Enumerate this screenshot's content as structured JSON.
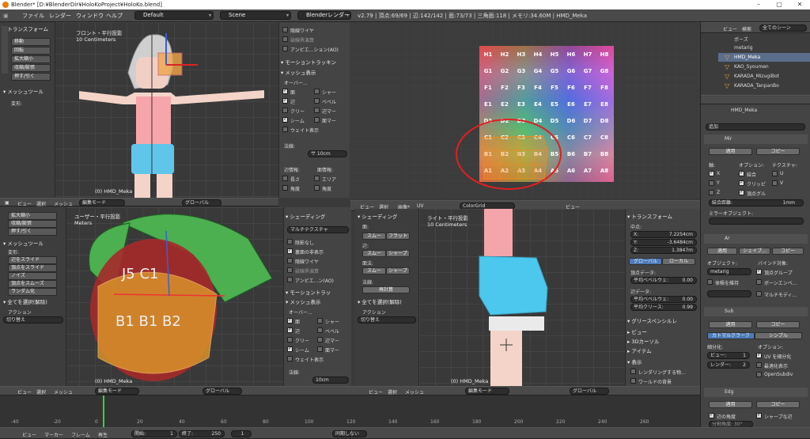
{
  "title": "Blender* [D:¥BlenderDir¥HoloKoProject¥HoloKo.blend]",
  "menu": [
    "ファイル",
    "レンダー",
    "ウィンドウ",
    "ヘルプ"
  ],
  "layout": "Default",
  "scene": "Scene",
  "engine": "Blenderレンダー",
  "stats": "v2.79 | 頂点:69/69 | 辺:142/142 | 面:73/73 | 三角面:118 | メモリ:34.60M | HMD_Meka",
  "left_tools": {
    "header": "▾ トランスフォーム",
    "buttons": [
      "移動",
      "回転",
      "拡大縮小",
      "収縮/膨張",
      "押す/引く"
    ],
    "mesh_tools": "▾ メッシュツール",
    "deform": "変形:"
  },
  "vp_tl": {
    "label": "フロント・平行投影",
    "units": "10 Centimeters",
    "obj": "(0) HMD_Meka"
  },
  "vp_bl": {
    "label": "ユーザー・平行投影",
    "units": "Meters",
    "obj": "(0) HMD_Meka"
  },
  "vp_br": {
    "label": "ライト・平行投影",
    "units": "10 Centimeters",
    "obj": "(0) HMD_Meka"
  },
  "mid_panel_top": {
    "items": [
      "隠線ワイヤ",
      "破線界演算",
      "アンビエ...ション(AO)"
    ],
    "motion": "▾ モーショントラッキン",
    "mesh_display": "▾ メッシュ表示",
    "overlay": "オーバー...",
    "opts": [
      [
        "面",
        "シャー"
      ],
      [
        "辺",
        "ベベル"
      ],
      [
        "クリー",
        "辺マー"
      ],
      [
        "シーム",
        "面マー"
      ]
    ],
    "weight": "ウェイト表示",
    "normal": "法線:",
    "size": "サ 10cm",
    "edge_info": "辺情報:",
    "face_info": "面情報:",
    "l1": "長さ",
    "l2": "エリア",
    "l3": "角度",
    "l4": "角度"
  },
  "mid_panel_bot": {
    "shading": "▾ シェーディング",
    "matcap": "マルチテクスチャ",
    "items": [
      "陰影なし",
      "裏面の非表示",
      "隠線ワイヤ",
      "破線界演算",
      "アンビエ...ン(AO)"
    ],
    "motion": "▾ モーショントラッ",
    "mesh_display": "▾ メッシュ表示",
    "overlay": "オーバー...",
    "opts": [
      [
        "面",
        "シャー"
      ],
      [
        "辺",
        "ベベル"
      ],
      [
        "クリー",
        "辺マー"
      ],
      [
        "シーム",
        "面マー"
      ]
    ],
    "weight": "ウェイト表示",
    "normal": "法線:",
    "size": "10cm"
  },
  "uv_panel": {
    "shading": "▾ シェーディング",
    "face": "面:",
    "b1": "スムー",
    "b2": "フラット",
    "edge": "辺:",
    "b3": "スムー",
    "b4": "シャープ",
    "uv": "面法:",
    "b5": "スムー",
    "b6": "シャープ",
    "normal": "法線:",
    "recalc": "再計算",
    "all_select": "▾ 全てを選択(解除)",
    "action": "アクション",
    "toggle": "切り替え"
  },
  "bl_tools": {
    "items": [
      "拡大縮小",
      "収縮/膨張",
      "押す/引く"
    ],
    "mesh_tool": "▾ メッシュツール",
    "deform": "変形:",
    "list": [
      "辺をスライド",
      "頂点をスライド",
      "ノイズ",
      "頂点をスムーズ",
      "ランダム化"
    ],
    "items2": [
      "押し出し",
      "押し出し",
      "個別に押し出し"
    ],
    "all_select": "▾ 全てを選択(解除)",
    "action": "アクション",
    "toggle": "切り替え"
  },
  "uv_header": {
    "view": "ビュー",
    "select": "選択",
    "image": "画像*",
    "uv": "UV",
    "img": "ColorGrid",
    "view2": "ビュー"
  },
  "grid_labels": [
    [
      "H1",
      "H2",
      "H3",
      "H4",
      "H5",
      "H6",
      "H7",
      "H8"
    ],
    [
      "G1",
      "G2",
      "G3",
      "G4",
      "G5",
      "G6",
      "G7",
      "G8"
    ],
    [
      "F1",
      "F2",
      "F3",
      "F4",
      "F5",
      "F6",
      "F7",
      "F8"
    ],
    [
      "E1",
      "E2",
      "E3",
      "E4",
      "E5",
      "E6",
      "E7",
      "E8"
    ],
    [
      "D1",
      "D2",
      "D3",
      "D4",
      "D5",
      "D6",
      "D7",
      "D8"
    ],
    [
      "C1",
      "C2",
      "C3",
      "C4",
      "C5",
      "C6",
      "C7",
      "C8"
    ],
    [
      "B1",
      "B2",
      "B3",
      "B4",
      "B5",
      "B6",
      "B7",
      "B8"
    ],
    [
      "A1",
      "A2",
      "A3",
      "A4",
      "A5",
      "A6",
      "A7",
      "A8"
    ]
  ],
  "outliner": {
    "view": "ビュー",
    "search": "検索",
    "all": "全てのシーン",
    "items": [
      "ポーズ",
      "metarig",
      "HMD_Meka",
      "KAO_Syoumen",
      "KARADA_MizugiBot",
      "KARADA_TanpanBo"
    ]
  },
  "props_right": {
    "transform": "▾ トランスフォーム",
    "center": "中点:",
    "x": "X:",
    "xv": "7.2254cm",
    "y": "Y:",
    "yv": "-3.6484cm",
    "z": "Z:",
    "zv": "1.3847m",
    "global": "グローバル",
    "local": "ローカル",
    "vert": "頂点データ:",
    "bevel1": "平均ベベルウェ:",
    "bevel1v": "0.00",
    "edge": "辺データ:",
    "bevel2": "平均ベベルウェ:",
    "bevel2v": "0.00",
    "crease": "平均クリース:",
    "creasev": "0.99",
    "gp": "▾ グリースペンシルレ",
    "view": "▸ ビュー",
    "cursor": "▸ 3Dカーソル",
    "item": "▸ アイテム",
    "display": "▾ 表示",
    "render_only": "レンダリングする物...",
    "world": "ワールドの背景"
  },
  "modifiers": {
    "obj": "HMD_Meka",
    "add": "追加",
    "mir": "Mir",
    "apply": "適用",
    "copy": "コピー",
    "axis": "軸:",
    "opt": "オプション:",
    "tex": "テクスチャ:",
    "x": "X",
    "y": "Y",
    "z": "Z",
    "merge": "結合",
    "clip": "クリッピ",
    "vgroup": "頂点グル",
    "u": "U",
    "v": "V",
    "merge_dist": "結合距離:",
    "merge_val": "1mm",
    "mirror_obj": "ミラーオブジェクト:",
    "ar": "Ar",
    "apply2": "適用",
    "shape": "シェイプ...",
    "copy2": "コピー",
    "object": "オブジェクト:",
    "bind": "バインド対象:",
    "metarig": "metarig",
    "vgroup2": "頂点グループ",
    "keep_vol": "体積を維持",
    "bone_env": "ボーンエンベ...",
    "multi": "マルチモディ...",
    "sub": "Sub",
    "apply3": "適用",
    "copy3": "コピー",
    "catmull": "カトマルクラーク",
    "simple": "シンプル",
    "subdiv": "細分化:",
    "opts2": "オプション:",
    "view_lbl": "ビュー:",
    "view_val": "1",
    "render_lbl": "レンダー:",
    "render_val": "2",
    "uv_smooth": "UV を細分化",
    "optimal": "最適化表示",
    "opensubdiv": "OpenSubdiv",
    "edg": "Edg",
    "apply4": "適用",
    "copy4": "コピー",
    "edge_angle": "辺の角度",
    "sharp": "シャープな辺",
    "split_angle": "分割角度: 30°"
  },
  "header3d": {
    "view": "ビュー",
    "select": "選択",
    "mesh": "メッシュ",
    "mode": "編集モード",
    "global": "グローバル"
  },
  "timeline": {
    "view": "ビュー",
    "marker": "マーカー",
    "frame": "フレーム",
    "play": "再生",
    "start": "開始:",
    "start_v": "1",
    "end": "終了:",
    "end_v": "250",
    "cur": "1",
    "sync": "同期しない",
    "ticks": [
      "-40",
      "-20",
      "0",
      "20",
      "40",
      "60",
      "80",
      "100",
      "120",
      "140",
      "160",
      "180",
      "200",
      "220",
      "240",
      "260"
    ]
  }
}
